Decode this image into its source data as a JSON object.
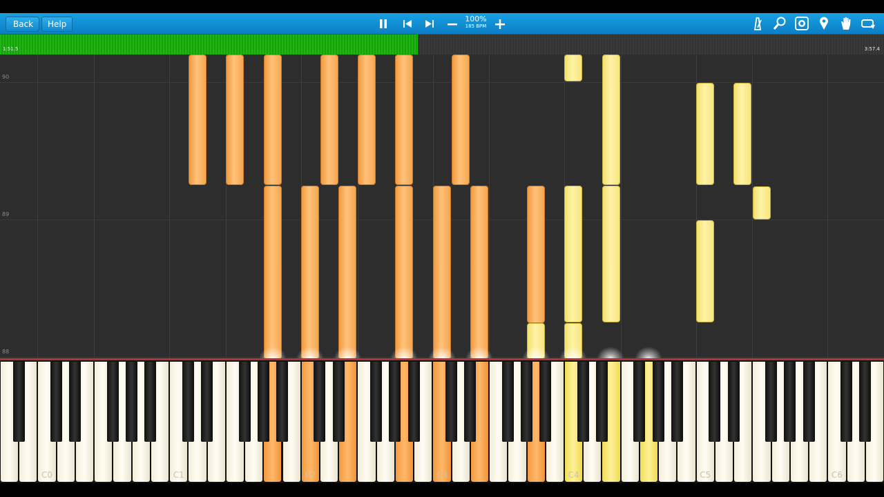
{
  "toolbar": {
    "back_label": "Back",
    "help_label": "Help",
    "speed_percent": "100%",
    "tempo": "185 BPM"
  },
  "icons": [
    "pause-icon",
    "skip-back-icon",
    "skip-forward-icon",
    "minus-icon",
    "plus-icon",
    "metronome-icon",
    "zoom-icon",
    "color-icon",
    "marker-icon",
    "hand-icon",
    "loop-icon"
  ],
  "progress": {
    "current_time": "1:51.5",
    "total_time": "3:57.4",
    "fraction": 0.473
  },
  "measures": [
    "90",
    "89",
    "88"
  ],
  "keyboard": {
    "octave_labels": [
      "C0",
      "C1",
      "C2",
      "C3",
      "C4",
      "C5",
      "C6"
    ]
  },
  "colors": {
    "toolbar": "#0b8fd6",
    "progress": "#1fb512",
    "left_hand": "#f6a54e",
    "right_hand": "#f7e17a",
    "keyline": "#b8323a"
  }
}
